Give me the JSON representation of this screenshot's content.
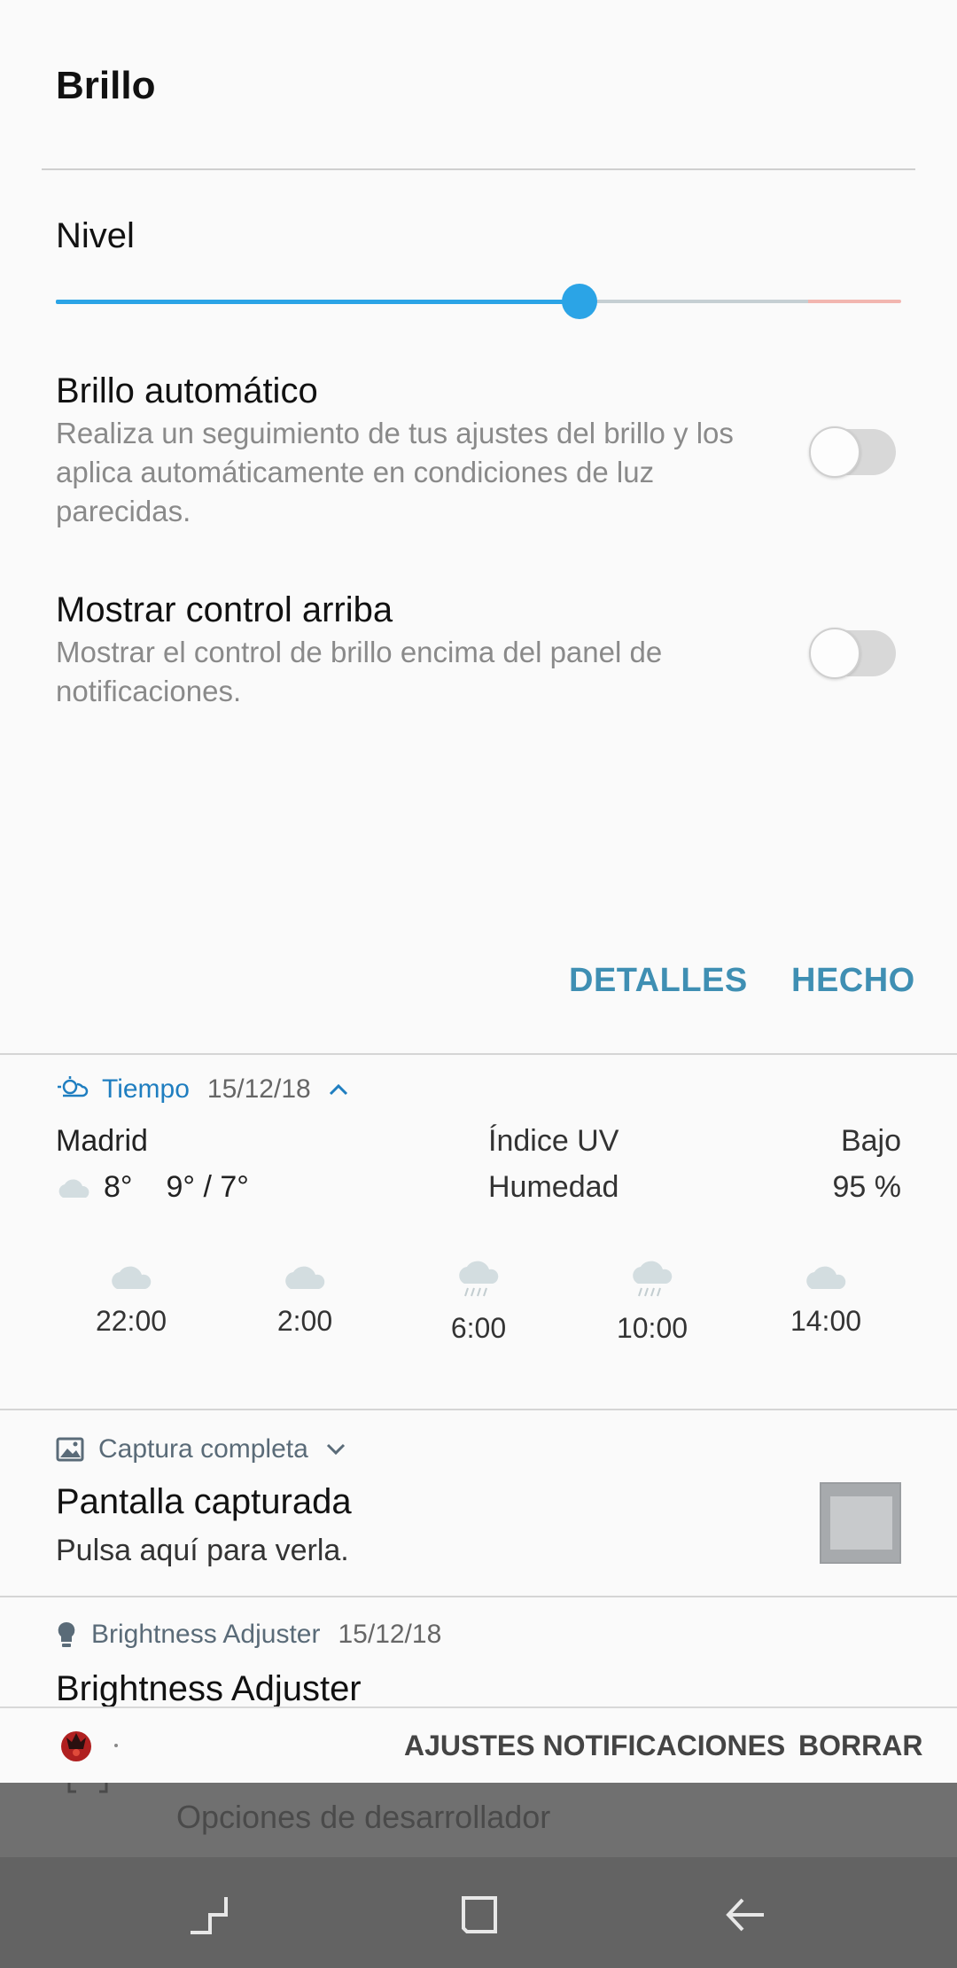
{
  "brightness": {
    "title": "Brillo",
    "level_label": "Nivel",
    "level_percent": 62,
    "auto_title": "Brillo automático",
    "auto_desc": "Realiza un seguimiento de tus ajustes del brillo y los aplica automáticamente en condiciones de luz parecidas.",
    "auto_enabled": false,
    "top_title": "Mostrar control arriba",
    "top_desc": "Mostrar el control de brillo encima del panel de notificaciones.",
    "top_enabled": false,
    "details_label": "DETALLES",
    "done_label": "HECHO",
    "colors": {
      "accent": "#2ba4e6",
      "track": "#c5cfd3",
      "warning_track": "#f2b6b0",
      "action": "#3f8fb3"
    }
  },
  "weather": {
    "app": "Tiempo",
    "date": "15/12/18",
    "city": "Madrid",
    "current_temp": "8°",
    "range": "9° / 7°",
    "uv_label": "Índice UV",
    "uv_value": "Bajo",
    "humidity_label": "Humedad",
    "humidity_value": "95 %",
    "forecast": [
      {
        "time": "22:00",
        "icon": "cloud-icon"
      },
      {
        "time": "2:00",
        "icon": "cloud-icon"
      },
      {
        "time": "6:00",
        "icon": "rain-cloud-icon"
      },
      {
        "time": "10:00",
        "icon": "rain-cloud-icon"
      },
      {
        "time": "14:00",
        "icon": "cloud-icon"
      }
    ]
  },
  "capture": {
    "app": "Captura completa",
    "title": "Pantalla capturada",
    "text": "Pulsa aquí para verla."
  },
  "adjuster": {
    "app": "Brightness Adjuster",
    "date": "15/12/18",
    "title": "Brightness Adjuster"
  },
  "bottom_bar": {
    "settings_label": "AJUSTES NOTIFICACIONES",
    "clear_label": "BORRAR"
  },
  "background": {
    "item_text": "Opciones de desarrollador"
  }
}
